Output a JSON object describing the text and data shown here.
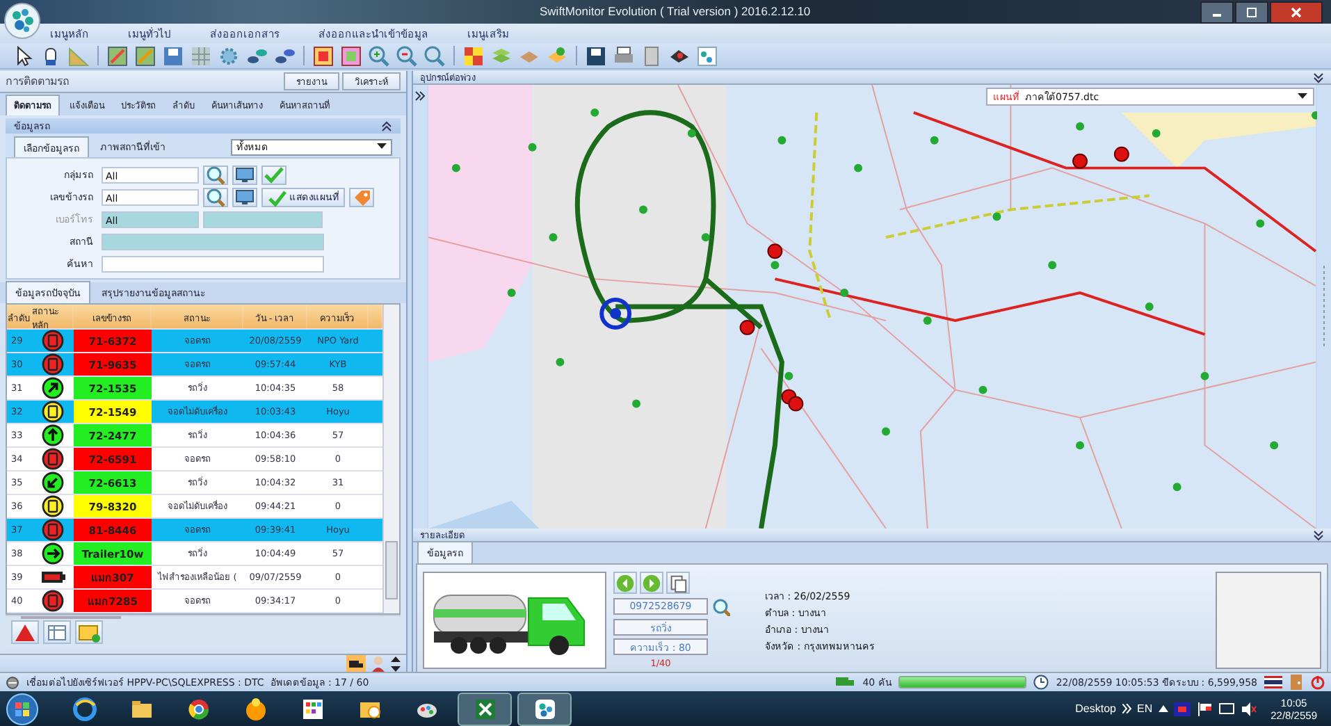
{
  "window": {
    "title": "SwiftMonitor Evolution ( Trial version ) 2016.2.12.10"
  },
  "menu": [
    "เมนูหลัก",
    "เมนูทั่วไป",
    "ส่งออกเอกสาร",
    "ส่งออกและนำเข้าข้อมูล",
    "เมนูเสริม"
  ],
  "left_panel": {
    "title": "การติดตามรถ",
    "buttons": [
      "รายงาน",
      "วิเคราะห์"
    ],
    "tabs": [
      {
        "label": "ติดตามรถ",
        "selected": true
      },
      {
        "label": "แจ้งเตือน",
        "selected": false
      },
      {
        "label": "ประวัติรถ",
        "selected": false
      },
      {
        "label": "ลำดับ",
        "selected": false
      },
      {
        "label": "ค้นหาเส้นทาง",
        "selected": false
      },
      {
        "label": "ค้นหาสถานที่",
        "selected": false
      }
    ],
    "section": "ข้อมูลรถ",
    "subtabs": [
      {
        "label": "เลือกข้อมูลรถ",
        "selected": true
      },
      {
        "label": "ภาพสถานีที่เข้า",
        "selected": false
      }
    ],
    "filter": "ทั้งหมด",
    "fields": [
      {
        "kind": "group",
        "label": "กลุ่มรถ",
        "value": "All",
        "disabled": false
      },
      {
        "kind": "vehicle",
        "label": "เลขข้างรถ",
        "value": "All",
        "disabled": false,
        "button": "แสดงแผนที่"
      },
      {
        "kind": "phone",
        "label": "เบอร์โทร",
        "value": "All",
        "disabled": true
      },
      {
        "kind": "station",
        "label": "สถานี",
        "disabled": false
      },
      {
        "kind": "search",
        "label": "ค้นหา",
        "disabled": false
      }
    ],
    "table_tabs": [
      {
        "label": "ข้อมูลรถปัจจุบัน",
        "selected": true
      },
      {
        "label": "สรุปรายงานข้อมูลสถานะ",
        "selected": false
      }
    ],
    "table": {
      "columns": [
        "ลำดับ",
        "สถานะหลัก",
        "เลขข้างรถ",
        "สถานะ",
        "วัน - เวลา",
        "ความเร็ว"
      ],
      "rows": [
        {
          "no": "29",
          "kind": "stop",
          "plate": "71-6372",
          "color": "#ff0000",
          "status": "จอดรถ",
          "time": "20/08/2559",
          "speed": "NPO Yard",
          "selected": true
        },
        {
          "no": "30",
          "kind": "stop",
          "plate": "71-9635",
          "color": "#ff0000",
          "status": "จอดรถ",
          "time": "09:57:44",
          "speed": "KYB",
          "selected": true
        },
        {
          "no": "31",
          "kind": "upright",
          "plate": "72-1535",
          "color": "#22ee22",
          "status": "รถวิ่ง",
          "time": "10:04:35",
          "speed": "58",
          "selected": false
        },
        {
          "no": "32",
          "kind": "idle",
          "plate": "72-1549",
          "color": "#ffff00",
          "status": "จอดไม่ดับเครื่อง",
          "time": "10:03:43",
          "speed": "Hoyu",
          "selected": true
        },
        {
          "no": "33",
          "kind": "up",
          "plate": "72-2477",
          "color": "#22ee22",
          "status": "รถวิ่ง",
          "time": "10:04:36",
          "speed": "57",
          "selected": false
        },
        {
          "no": "34",
          "kind": "stop",
          "plate": "72-6591",
          "color": "#ff0000",
          "status": "จอดรถ",
          "time": "09:58:10",
          "speed": "0",
          "selected": false
        },
        {
          "no": "35",
          "kind": "downleft",
          "plate": "72-6613",
          "color": "#22ee22",
          "status": "รถวิ่ง",
          "time": "10:04:32",
          "speed": "31",
          "selected": false
        },
        {
          "no": "36",
          "kind": "idle",
          "plate": "79-8320",
          "color": "#ffff00",
          "status": "จอดไม่ดับเครื่อง",
          "time": "09:44:21",
          "speed": "0",
          "selected": false
        },
        {
          "no": "37",
          "kind": "stop",
          "plate": "81-8446",
          "color": "#ff0000",
          "status": "จอดรถ",
          "time": "09:39:41",
          "speed": "Hoyu",
          "selected": true
        },
        {
          "no": "38",
          "kind": "right",
          "plate": "Trailer10w",
          "color": "#22ee22",
          "status": "รถวิ่ง",
          "time": "10:04:49",
          "speed": "57",
          "selected": false
        },
        {
          "no": "39",
          "kind": "battery",
          "plate": "แมก307",
          "color": "#ff0000",
          "status": "ไฟสำรองเหลือน้อย (",
          "time": "09/07/2559",
          "speed": "0",
          "selected": false
        },
        {
          "no": "40",
          "kind": "stop",
          "plate": "แมก7285",
          "color": "#ff0000",
          "status": "จอดรถ",
          "time": "09:34:17",
          "speed": "0",
          "selected": false
        }
      ]
    }
  },
  "map_panel": {
    "title": "อุปกรณ์ต่อพ่วง",
    "map_label": "แผนที่",
    "map_file": "ภาคใต้0757.dtc"
  },
  "detail_panel": {
    "title": "รายละเอียด",
    "tabs": [
      {
        "label": "ข้อมูลรถ",
        "selected": true
      }
    ],
    "phone": "0972528679",
    "status": "รถวิ่ง",
    "speed": "ความเร็ว : 80",
    "page": "1/40",
    "info": [
      "เวลา : 26/02/2559",
      "ตำบล : บางนา",
      "อำเภอ : บางนา",
      "จังหวัด : กรุงเทพมหานคร"
    ]
  },
  "status_bar": {
    "connection": "เชื่อมต่อไปยังเซิร์ฟเวอร์ HPPV-PC\\SQLEXPRESS : DTC",
    "update": "อัพเดตข้อมูล : 17 / 60",
    "vehicles": "40 คัน",
    "progress": {
      "level": 1
    },
    "clock": "22/08/2559 10:05:53 ขีดระบบ : 6,599,958"
  },
  "taskbar": {
    "desktop": "Desktop",
    "language": "EN",
    "time": "10:05",
    "date": "22/8/2559"
  }
}
